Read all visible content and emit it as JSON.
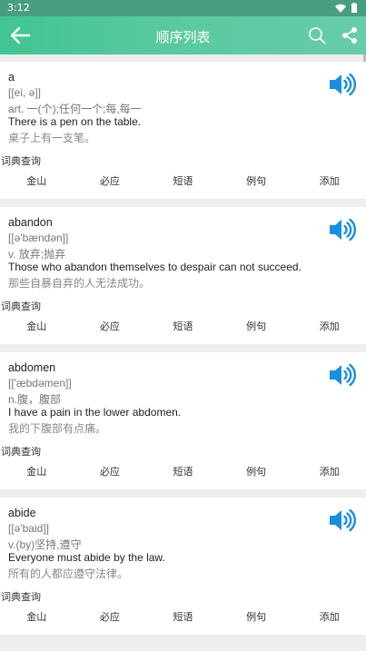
{
  "status_bar": {
    "time": "3:12"
  },
  "toolbar": {
    "title": "顺序列表"
  },
  "entries": [
    {
      "word": "a",
      "phonetic": "[[ei, ə]]",
      "definition": "art. 一(个);任何一个;每,每一",
      "example_en": "There is a pen on the table.",
      "example_zh": "桌子上有一支笔。",
      "dict_label": "词典查询",
      "actions": [
        "金山",
        "必应",
        "短语",
        "例句",
        "添加"
      ]
    },
    {
      "word": "abandon",
      "phonetic": "[[ə'bændən]]",
      "definition": "v. 放弃;抛弃",
      "example_en": "Those who abandon themselves to despair can not succeed.",
      "example_zh": "那些自暴自弃的人无法成功。",
      "dict_label": "词典查询",
      "actions": [
        "金山",
        "必应",
        "短语",
        "例句",
        "添加"
      ]
    },
    {
      "word": "abdomen",
      "phonetic": "[['æbdəmen]]",
      "definition": "n.腹，腹部",
      "example_en": "I have a pain in the lower abdomen.",
      "example_zh": "我的下腹部有点痛。",
      "dict_label": "词典查询",
      "actions": [
        "金山",
        "必应",
        "短语",
        "例句",
        "添加"
      ]
    },
    {
      "word": "abide",
      "phonetic": "[[ə'baid]]",
      "definition": "v.(by)坚持,遵守",
      "example_en": "Everyone must abide by the law.",
      "example_zh": "所有的人都应遵守法律。",
      "dict_label": "词典查询",
      "actions": [
        "金山",
        "必应",
        "短语",
        "例句",
        "添加"
      ]
    }
  ]
}
